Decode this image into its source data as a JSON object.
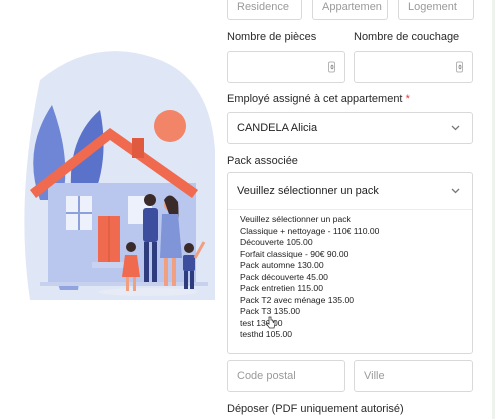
{
  "top_row": {
    "residence_placeholder": "Residence",
    "appartement_placeholder": "Appartemen",
    "logement_placeholder": "Logement"
  },
  "rooms": {
    "pieces_label": "Nombre de pièces",
    "couchage_label": "Nombre de couchage"
  },
  "employee": {
    "label": "Employé assigné à cet appartement",
    "required_mark": "*",
    "value": "CANDELA Alicia"
  },
  "pack": {
    "label": "Pack associée",
    "placeholder": "Veuillez sélectionner un pack",
    "options": [
      "Veuillez sélectionner un pack",
      "Classique + nettoyage - 110€ 110.00",
      "Découverte 105.00",
      "Forfait classique - 90€ 90.00",
      "Pack automne 130.00",
      "Pack découverte 45.00",
      "Pack entretien 115.00",
      "Pack T2 avec ménage 135.00",
      "Pack T3 135.00",
      "test 130.00",
      "testhd 105.00"
    ]
  },
  "address": {
    "postal_placeholder": "Code postal",
    "city_placeholder": "Ville"
  },
  "upload": {
    "label": "Déposer (PDF uniquement autorisé)"
  },
  "icons": {
    "spinner": "number-spinner-icon",
    "chevron": "chevron-down-icon",
    "cursor": "mouse-cursor-icon"
  },
  "colors": {
    "house_roof": "#ef6a4f",
    "illustration_blob": "#dde6f7",
    "sun": "#f28467",
    "accent_required": "#e53935"
  }
}
